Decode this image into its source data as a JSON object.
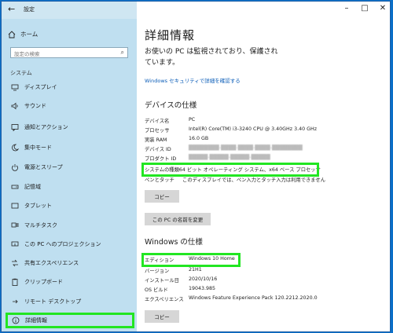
{
  "window": {
    "title": "設定",
    "back_icon": "back-arrow-icon",
    "controls": [
      "–",
      "□",
      "✕"
    ]
  },
  "sidebar": {
    "home": "ホーム",
    "search_placeholder": "設定の検索",
    "section": "システム",
    "items": [
      {
        "label": "ディスプレイ",
        "icon": "display-icon"
      },
      {
        "label": "サウンド",
        "icon": "sound-icon"
      },
      {
        "label": "通知とアクション",
        "icon": "notification-icon"
      },
      {
        "label": "集中モード",
        "icon": "focus-moon-icon"
      },
      {
        "label": "電源とスリープ",
        "icon": "power-icon"
      },
      {
        "label": "記憶域",
        "icon": "storage-icon"
      },
      {
        "label": "タブレット",
        "icon": "tablet-icon"
      },
      {
        "label": "マルチタスク",
        "icon": "multitask-icon"
      },
      {
        "label": "この PC へのプロジェクション",
        "icon": "projection-icon"
      },
      {
        "label": "共有エクスペリエンス",
        "icon": "shared-experience-icon"
      },
      {
        "label": "クリップボード",
        "icon": "clipboard-icon"
      },
      {
        "label": "リモート デスクトップ",
        "icon": "remote-desktop-icon"
      },
      {
        "label": "詳細情報",
        "icon": "info-icon"
      }
    ]
  },
  "main": {
    "title": "詳細情報",
    "protect_text": "お使いの PC は監視されており、保護されています。",
    "security_link": "Windows セキュリティで詳細を確認する",
    "device_heading": "デバイスの仕様",
    "device_specs": [
      {
        "key": "デバイス名",
        "value": "PC"
      },
      {
        "key": "プロセッサ",
        "value": "Intel(R) Core(TM) i3-3240 CPU @ 3.40GHz   3.40 GHz"
      },
      {
        "key": "実装 RAM",
        "value": "16.0 GB"
      },
      {
        "key": "デバイス ID",
        "value": "████████-████-████-████-████████"
      },
      {
        "key": "プロダクト ID",
        "value": "█████-█████-█████-█████"
      },
      {
        "key": "システムの種類",
        "value": "64 ビット オペレーティング システム、x64 ベース プロセッサ"
      },
      {
        "key": "ペンとタッチ",
        "value": "このディスプレイでは、ペン入力とタッチ入力は利用できません"
      }
    ],
    "copy_button": "コピー",
    "rename_button": "この PC の名前を変更",
    "windows_heading": "Windows の仕様",
    "windows_specs": [
      {
        "key": "エディション",
        "value": "Windows 10 Home"
      },
      {
        "key": "バージョン",
        "value": "21H1"
      },
      {
        "key": "インストール日",
        "value": "2020/10/16"
      },
      {
        "key": "OS ビルド",
        "value": "19043.985"
      },
      {
        "key": "エクスペリエンス",
        "value": "Windows Feature Experience Pack 120.2212.2020.0"
      }
    ],
    "copy_button2": "コピー"
  },
  "colors": {
    "sidebar_bg": "#bfdff0",
    "highlight": "#22e622",
    "link": "#0b5db8",
    "desktop": "#0a6fc8"
  }
}
